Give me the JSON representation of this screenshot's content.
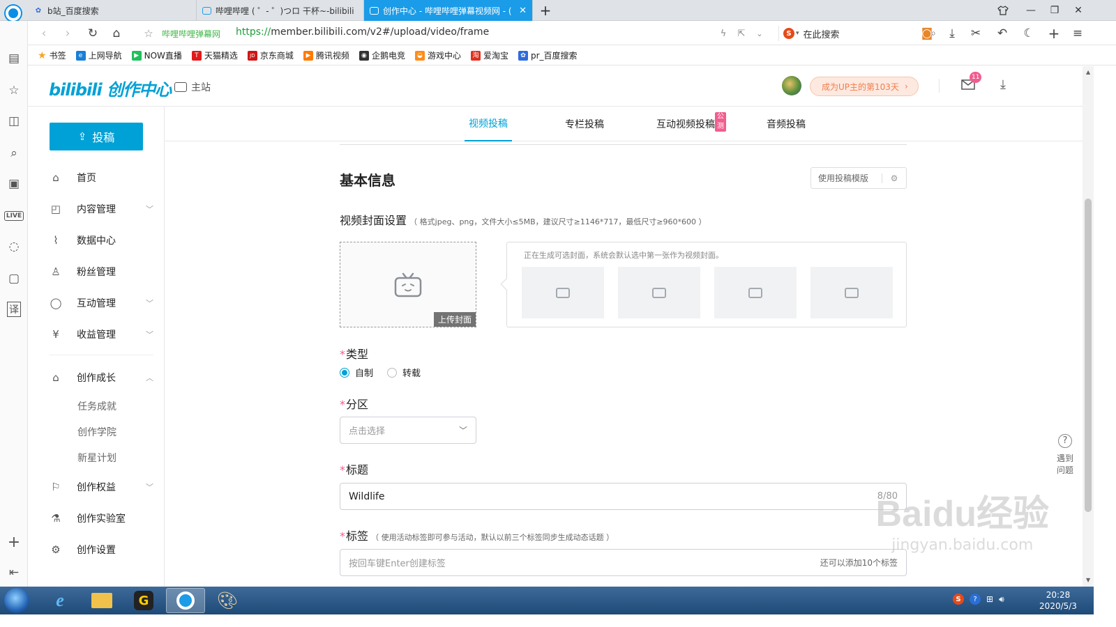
{
  "browser": {
    "tabs": [
      {
        "title": "b站_百度搜索",
        "active": false
      },
      {
        "title": "哔哩哔哩 ( ゜- ゜)つロ 干杯~-bilibili",
        "active": false
      },
      {
        "title": "创作中心 - 哔哩哔哩弹幕视频网 - (",
        "active": true
      }
    ],
    "address": {
      "site_label": "哔哩哔哩弹幕网",
      "scheme": "https://",
      "url_rest": "member.bilibili.com/v2#/upload/video/frame",
      "search_placeholder": "在此搜索"
    },
    "bookmarks": [
      {
        "label": "书签",
        "color": "#f5a623",
        "glyph": "★"
      },
      {
        "label": "上网导航",
        "color": "#1a7fd6",
        "glyph": "e"
      },
      {
        "label": "NOW直播",
        "color": "#20c05c",
        "glyph": "▶"
      },
      {
        "label": "天猫精选",
        "color": "#e21a1a",
        "glyph": "T"
      },
      {
        "label": "京东商城",
        "color": "#d01616",
        "glyph": "JD"
      },
      {
        "label": "腾讯视频",
        "color": "#ff7a00",
        "glyph": "▶"
      },
      {
        "label": "企鹅电竞",
        "color": "#333333",
        "glyph": "◉"
      },
      {
        "label": "游戏中心",
        "color": "#ff8c1a",
        "glyph": "◒"
      },
      {
        "label": "爱淘宝",
        "color": "#e0301e",
        "glyph": "淘"
      },
      {
        "label": "pr_百度搜索",
        "color": "#2f6bdc",
        "glyph": "✿"
      }
    ]
  },
  "header": {
    "logo_text": "bilibili 创作中心",
    "main_site": "主站",
    "up_badge": "成为UP主的第103天",
    "mail_count": "11"
  },
  "sidebar": {
    "upload_button": "投稿",
    "items": [
      {
        "label": "首页",
        "icon": "home-icon"
      },
      {
        "label": "内容管理",
        "icon": "content-icon",
        "expandable": true
      },
      {
        "label": "数据中心",
        "icon": "chart-icon"
      },
      {
        "label": "粉丝管理",
        "icon": "user-icon"
      },
      {
        "label": "互动管理",
        "icon": "chat-icon",
        "expandable": true
      },
      {
        "label": "收益管理",
        "icon": "money-icon",
        "expandable": true
      },
      {
        "label": "创作成长",
        "icon": "graduation-icon",
        "expanded": true
      },
      {
        "label": "创作权益",
        "icon": "flag-icon",
        "expandable": true
      },
      {
        "label": "创作实验室",
        "icon": "flask-icon"
      },
      {
        "label": "创作设置",
        "icon": "settings-icon"
      }
    ],
    "sub_items": [
      "任务成就",
      "创作学院",
      "新星计划"
    ]
  },
  "tabs": [
    "视频投稿",
    "专栏投稿",
    "互动视频投稿",
    "音频投稿"
  ],
  "tab_badge": "公测",
  "form": {
    "section_title": "基本信息",
    "template_button": "使用投稿模版",
    "cover_label": "视频封面设置",
    "cover_hint": "（ 格式jpeg、png，文件大小≤5MB，建议尺寸≥1146*717，最低尺寸≥960*600 ）",
    "upload_cover": "上传封面",
    "generating_hint": "正在生成可选封面，系统会默认选中第一张作为视频封面。",
    "type_label": "类型",
    "type_options": [
      "自制",
      "转载"
    ],
    "zone_label": "分区",
    "zone_placeholder": "点击选择",
    "title_label": "标题",
    "title_value": "Wildlife",
    "title_count": "8/80",
    "tags_label": "标签",
    "tags_hint": "（ 使用活动标签即可参与活动，默认以前三个标签同步生成动态话题 ）",
    "tags_placeholder": "按回车键Enter创建标签",
    "tags_remaining": "还可以添加10个标签"
  },
  "help": {
    "label_line1": "遇到",
    "label_line2": "问题"
  },
  "taskbar": {
    "time": "20:28",
    "date": "2020/5/3"
  },
  "watermark": {
    "main": "Baidu经验",
    "sub": "jingyan.baidu.com"
  },
  "colors": {
    "accent": "#00a1d6",
    "required": "#f25d8e",
    "up_badge_bg": "#fde9df",
    "up_badge_text": "#f47c4d",
    "tab_active": "#1a9ce8"
  }
}
